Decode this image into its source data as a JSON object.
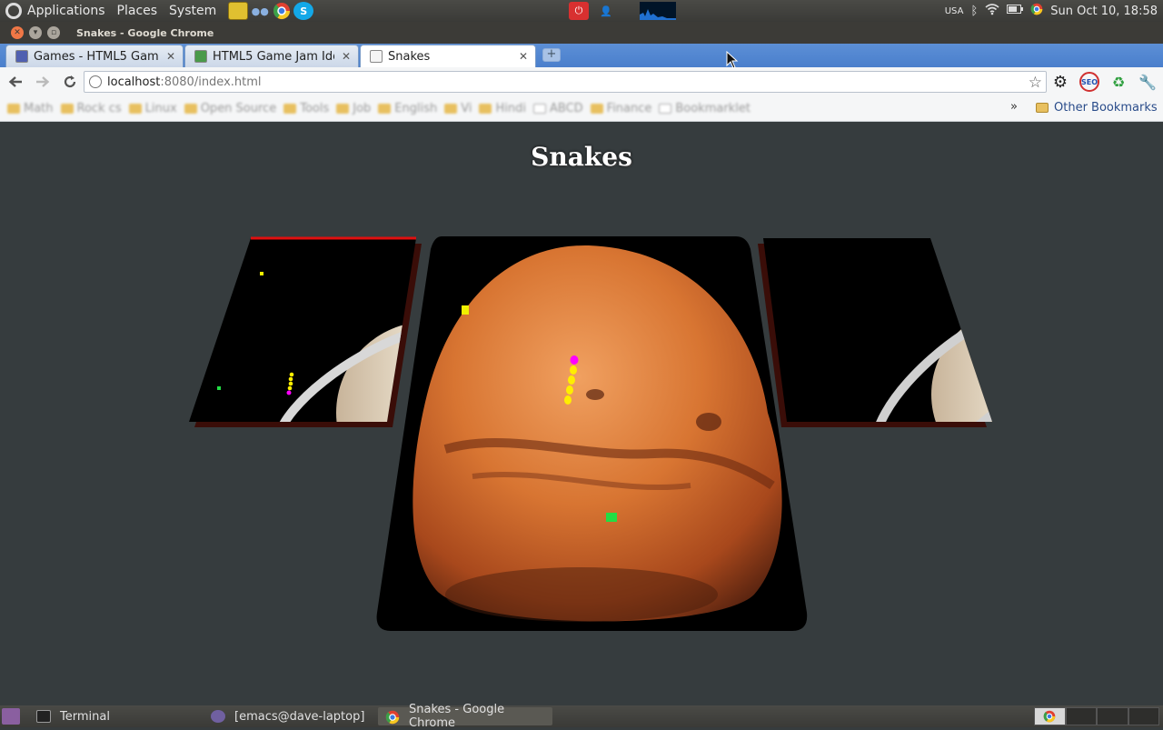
{
  "top_panel": {
    "menus": [
      "Applications",
      "Places",
      "System"
    ],
    "keyboard_layout": "USA",
    "clock": "Sun Oct 10, 18:58"
  },
  "window": {
    "title": "Snakes - Google Chrome"
  },
  "tabs": [
    {
      "label": "Games - HTML5 Gam…",
      "active": false
    },
    {
      "label": "HTML5 Game Jam Ide…",
      "active": false
    },
    {
      "label": "Snakes",
      "active": true
    }
  ],
  "omnibox": {
    "host": "localhost",
    "path": ":8080/index.html"
  },
  "bookmarks": {
    "items": [
      "Math",
      "Rock cs",
      "Linux",
      "Open Source",
      "Tools",
      "Job",
      "English",
      "Vi",
      "Hindi",
      "ABCD",
      "Finance",
      "Bookmarklet"
    ],
    "overflow": "»",
    "other_label": "Other Bookmarks"
  },
  "page": {
    "title": "Snakes"
  },
  "taskbar": {
    "items": [
      {
        "label": "Terminal"
      },
      {
        "label": "[emacs@dave-laptop]"
      },
      {
        "label": "Snakes - Google Chrome",
        "active": true
      }
    ]
  },
  "colors": {
    "background": "#363c3e",
    "snake_head": "#ff00ff",
    "snake_body": "#ffee00",
    "food_yellow": "#f0f000",
    "food_green": "#22dd44",
    "mars": "#d86a28"
  }
}
